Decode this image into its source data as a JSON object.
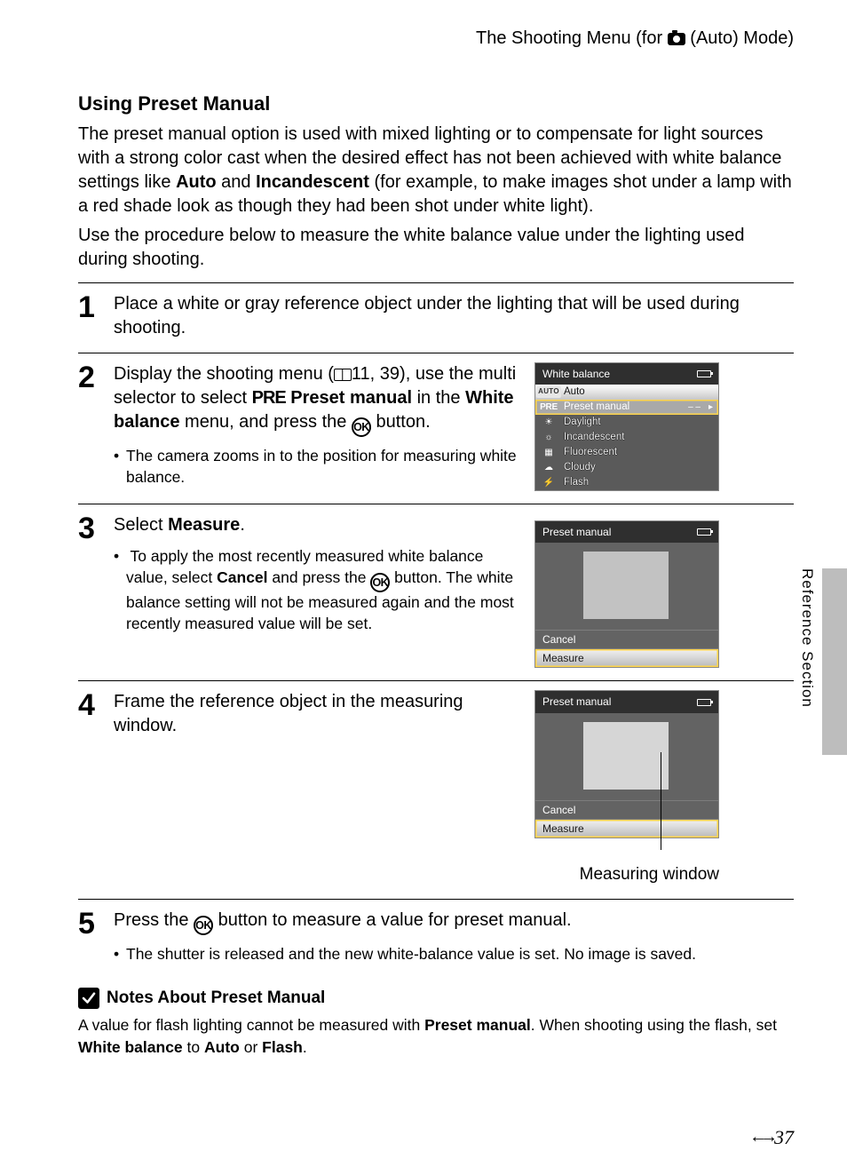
{
  "header": {
    "prefix": "The Shooting Menu (for ",
    "suffix": " (Auto) Mode)"
  },
  "section_title": "Using Preset Manual",
  "intro": {
    "p1a": "The preset manual option is used with mixed lighting or to compensate for light sources with a strong color cast when the desired effect has not been achieved with white balance settings like ",
    "p1_bold1": "Auto",
    "p1_mid": " and ",
    "p1_bold2": "Incandescent",
    "p1b": " (for example, to make images shot under a lamp with a red shade look as though they had been shot under white light).",
    "p2": "Use the procedure below to measure the white balance value under the lighting used during shooting."
  },
  "steps": {
    "s1": {
      "num": "1",
      "text": "Place a white or gray reference object under the lighting that will be used during shooting."
    },
    "s2": {
      "num": "2",
      "t1": "Display the shooting menu (",
      "t2": "11, 39), use the multi selector to select ",
      "pre": "PRE",
      "t3": " Preset manual",
      "t4": " in the ",
      "wb": "White balance",
      "t5": " menu, and press the ",
      "t6": " button.",
      "bullet": "The camera zooms in to the position for measuring white balance."
    },
    "s3": {
      "num": "3",
      "t1": "Select ",
      "t2": "Measure",
      "t3": ".",
      "b1a": "To apply the most recently measured white balance value, select ",
      "b1_cancel": "Cancel",
      "b1b": " and press the ",
      "b1c": " button. The white balance setting will not be measured again and the most recently measured value will be set."
    },
    "s4": {
      "num": "4",
      "text": "Frame the reference object in the measuring window.",
      "caption": "Measuring window"
    },
    "s5": {
      "num": "5",
      "t1": "Press the ",
      "t2": " button to measure a value for preset manual.",
      "bullet": "The shutter is released and the new white-balance value is set. No image is saved."
    }
  },
  "wb_panel": {
    "title": "White balance",
    "items": [
      {
        "icon": "AUTO",
        "label": "Auto"
      },
      {
        "icon": "PRE",
        "label": "Preset manual",
        "tail": "– –"
      },
      {
        "icon": "sun",
        "label": "Daylight"
      },
      {
        "icon": "bulb",
        "label": "Incandescent"
      },
      {
        "icon": "tube",
        "label": "Fluorescent"
      },
      {
        "icon": "cloud",
        "label": "Cloudy"
      },
      {
        "icon": "flash",
        "label": "Flash"
      }
    ]
  },
  "preset_panel": {
    "title": "Preset manual",
    "cancel": "Cancel",
    "measure": "Measure"
  },
  "notes": {
    "heading": "Notes About Preset Manual",
    "p1a": "A value for flash lighting cannot be measured with ",
    "p1_bold1": "Preset manual",
    "p1b": ". When shooting using the flash, set ",
    "p1_bold2": "White balance",
    "p1c": " to ",
    "p1_bold3": "Auto",
    "p1d": " or ",
    "p1_bold4": "Flash",
    "p1e": "."
  },
  "side_label": "Reference Section",
  "page_number": "37"
}
